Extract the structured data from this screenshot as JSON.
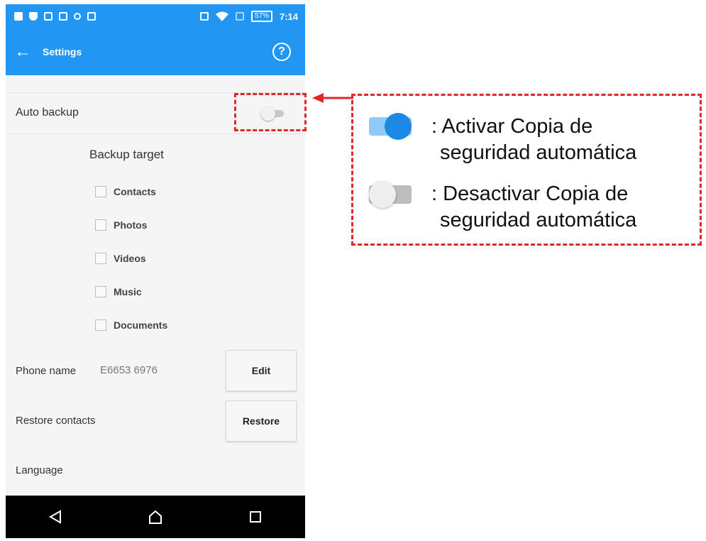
{
  "status_bar": {
    "battery": "57%",
    "time": "7:14"
  },
  "app_bar": {
    "title": "Settings",
    "back_icon": "arrow-back-icon",
    "help_icon": "help-circle-icon"
  },
  "auto_backup": {
    "label": "Auto backup",
    "enabled": false
  },
  "backup_target": {
    "title": "Backup target",
    "items": [
      {
        "label": "Contacts",
        "checked": false
      },
      {
        "label": "Photos",
        "checked": false
      },
      {
        "label": "Videos",
        "checked": false
      },
      {
        "label": "Music",
        "checked": false
      },
      {
        "label": "Documents",
        "checked": false
      }
    ]
  },
  "phone_name": {
    "label": "Phone name",
    "value": "E6653 6976",
    "button": "Edit"
  },
  "restore_contacts": {
    "label": "Restore contacts",
    "button": "Restore"
  },
  "language": {
    "label": "Language"
  },
  "nav": {
    "back_icon": "nav-back-icon",
    "home_icon": "nav-home-icon",
    "recents_icon": "nav-recents-icon"
  },
  "legend": {
    "on_text": ": Activar Copia de seguridad automática",
    "on_line1": ": Activar Copia de",
    "on_line2": "seguridad automática",
    "off_line1": ": Desactivar Copia de",
    "off_line2": "seguridad automática"
  },
  "colors": {
    "accent": "#2196f3",
    "annotation": "#e02828",
    "toggle_on": "#1e88e5"
  }
}
